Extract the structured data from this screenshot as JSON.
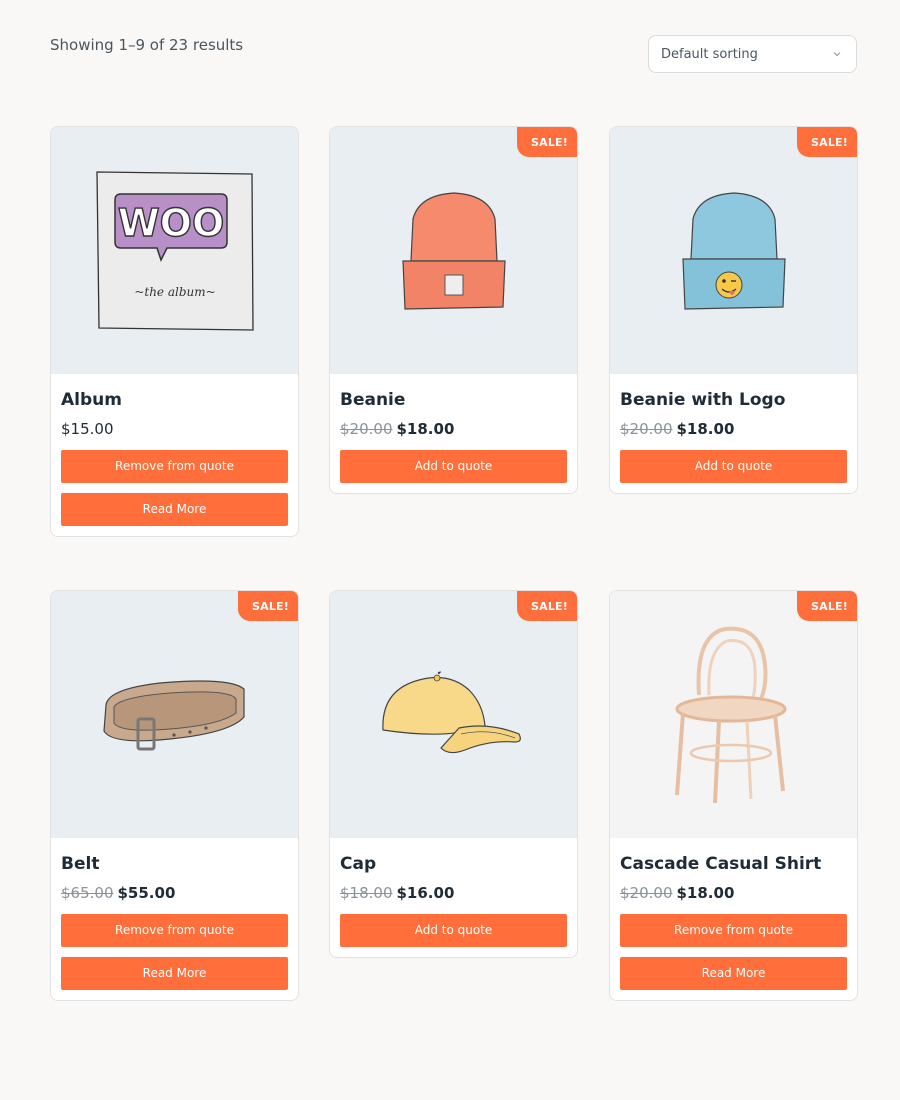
{
  "header": {
    "result_count": "Showing 1–9 of 23 results",
    "sort_selected": "Default sorting"
  },
  "products": [
    {
      "title": "Album",
      "price_regular": "$15.00",
      "buttons": [
        "Remove from quote",
        "Read More"
      ],
      "image": "album-illustration"
    },
    {
      "title": "Beanie",
      "badge": "SALE!",
      "price_old": "$20.00",
      "price_new": "$18.00",
      "buttons": [
        "Add to quote"
      ],
      "image": "beanie-illustration"
    },
    {
      "title": "Beanie with Logo",
      "badge": "SALE!",
      "price_old": "$20.00",
      "price_new": "$18.00",
      "buttons": [
        "Add to quote"
      ],
      "image": "beanie-logo-illustration"
    },
    {
      "title": "Belt",
      "badge": "SALE!",
      "price_old": "$65.00",
      "price_new": "$55.00",
      "buttons": [
        "Remove from quote",
        "Read More"
      ],
      "image": "belt-illustration"
    },
    {
      "title": "Cap",
      "badge": "SALE!",
      "price_old": "$18.00",
      "price_new": "$16.00",
      "buttons": [
        "Add to quote"
      ],
      "image": "cap-illustration"
    },
    {
      "title": "Cascade Casual Shirt",
      "badge": "SALE!",
      "price_old": "$20.00",
      "price_new": "$18.00",
      "buttons": [
        "Remove from quote",
        "Read More"
      ],
      "image": "chair-photo"
    }
  ],
  "colors": {
    "accent": "#ff6e3b",
    "text": "#1f2b36",
    "thumb_bg": "#e9eef2",
    "page_bg": "#f9f8f6"
  }
}
